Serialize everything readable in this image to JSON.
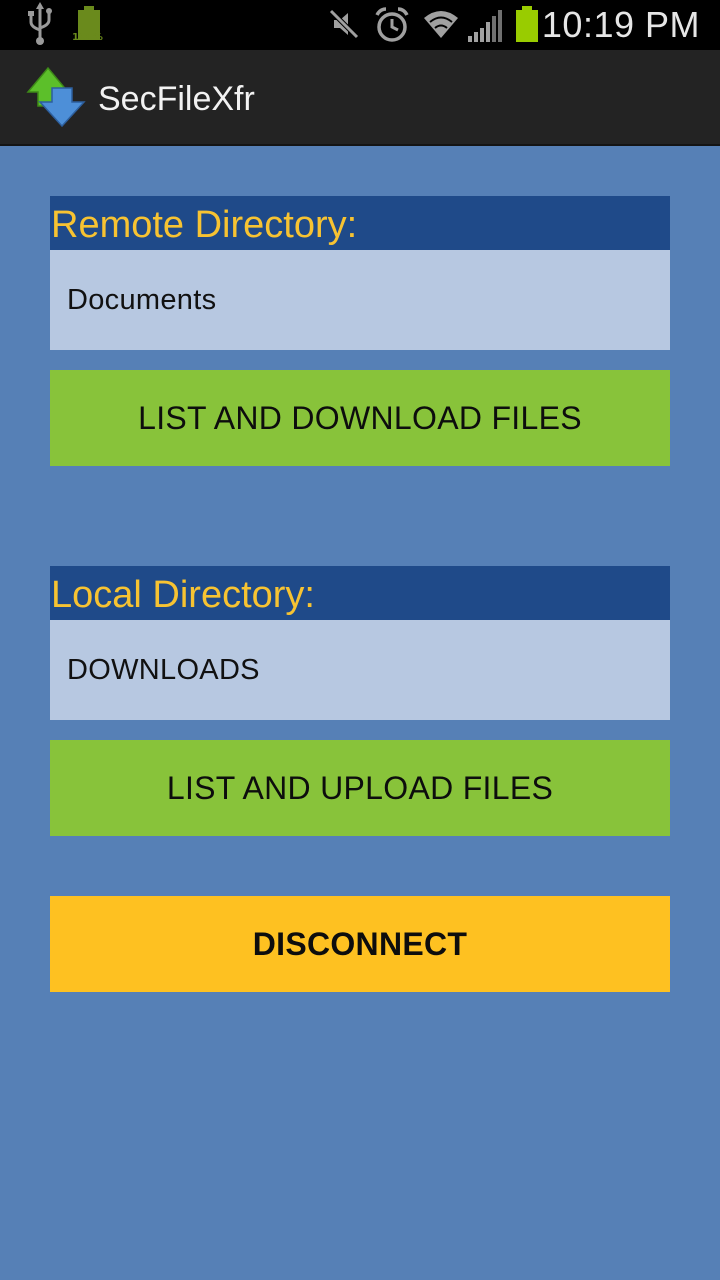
{
  "status_bar": {
    "time": "10:19 PM",
    "battery_percent_label": "100%",
    "icons": [
      "usb-icon",
      "battery-status-icon",
      "mute-icon",
      "alarm-icon",
      "wifi-icon",
      "signal-icon",
      "battery-icon"
    ]
  },
  "app": {
    "title": "SecFileXfr",
    "logo_icon": "transfer-arrows-icon"
  },
  "remote": {
    "label": "Remote Directory:",
    "value": "Documents",
    "button_label": "LIST AND DOWNLOAD FILES"
  },
  "local": {
    "label": "Local Directory:",
    "value": "DOWNLOADS",
    "button_label": "LIST AND UPLOAD FILES"
  },
  "disconnect": {
    "label": "DISCONNECT"
  },
  "colors": {
    "background": "#5680b6",
    "header_bg": "#1f4a89",
    "header_text": "#f7c332",
    "field_bg": "#b7c8e1",
    "button_green": "#88c33a",
    "button_yellow": "#fec121",
    "action_bar": "#232323"
  }
}
